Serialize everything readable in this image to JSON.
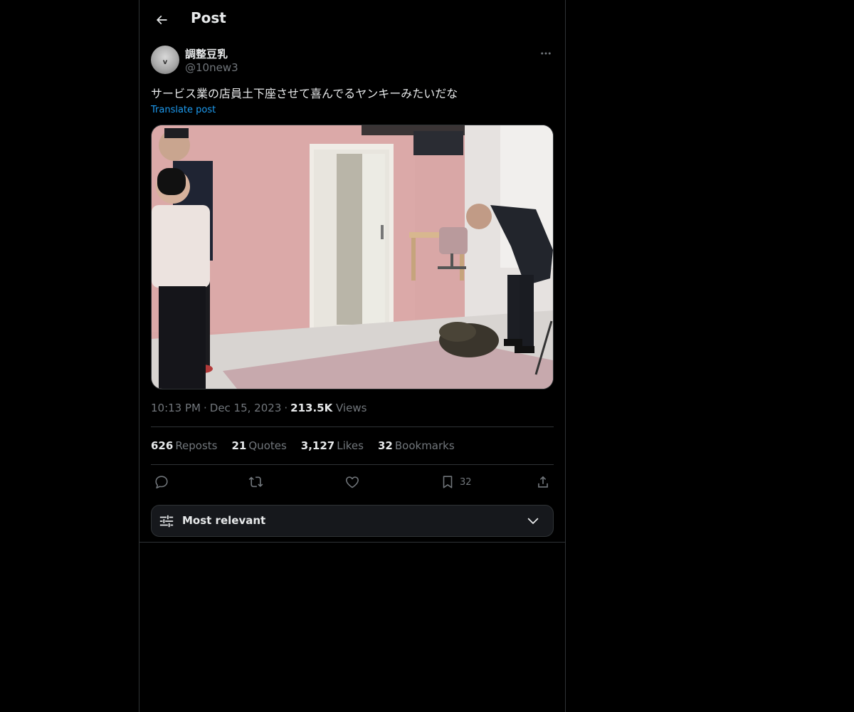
{
  "header": {
    "title": "Post",
    "back_icon": "arrow-left-icon"
  },
  "post": {
    "author": {
      "name": "調整豆乳",
      "handle": "@10new3",
      "avatar_glyph": "v"
    },
    "text": "サービス業の店員土下座させて喜んでるヤンキーみたいだな",
    "translate_label": "Translate post",
    "media_description_icon": "photo-icon",
    "time": "10:13 PM",
    "date": "Dec 15, 2023",
    "views_count": "213.5K",
    "views_label": "Views",
    "stats": {
      "reposts": {
        "count": "626",
        "label": "Reposts"
      },
      "quotes": {
        "count": "21",
        "label": "Quotes"
      },
      "likes": {
        "count": "3,127",
        "label": "Likes"
      },
      "bookmarks": {
        "count": "32",
        "label": "Bookmarks"
      }
    },
    "actions": {
      "reply_icon": "reply-icon",
      "repost_icon": "repost-icon",
      "like_icon": "heart-icon",
      "bookmark_icon": "bookmark-icon",
      "bookmark_count": "32",
      "share_icon": "share-icon"
    }
  },
  "sort": {
    "label": "Most relevant",
    "icon": "sliders-icon",
    "chevron": "chevron-down-icon"
  },
  "colors": {
    "background": "#000000",
    "text_primary": "#e7e9ea",
    "text_secondary": "#71767b",
    "link": "#1d9bf0",
    "border": "#2f3336",
    "sort_bg": "#16181c"
  }
}
